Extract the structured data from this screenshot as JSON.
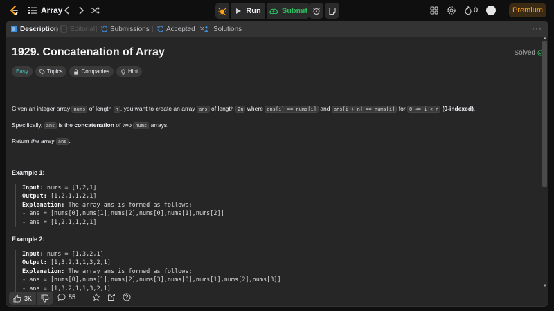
{
  "topbar": {
    "problem_list_title": "Array",
    "run_label": "Run",
    "submit_label": "Submit",
    "streak_count": "0",
    "premium_label": "Premium"
  },
  "tabs": [
    {
      "label": "Description",
      "state": "active",
      "icon": "description-icon"
    },
    {
      "label": "Editorial",
      "state": "disabled",
      "icon": "editorial-icon"
    },
    {
      "label": "Submissions",
      "state": "normal",
      "icon": "submissions-icon"
    },
    {
      "label": "Accepted",
      "state": "normal",
      "icon": "accepted-icon"
    },
    {
      "label": "Solutions",
      "state": "normal",
      "icon": "solutions-icon"
    }
  ],
  "problem": {
    "title": "1929. Concatenation of Array",
    "status": "Solved",
    "difficulty": "Easy",
    "chips": [
      "Topics",
      "Companies",
      "Hint"
    ],
    "desc1": {
      "t1": "Given an integer array ",
      "c1": "nums",
      "t2": " of length ",
      "c2": "n",
      "t3": ", you want to create an array ",
      "c3": "ans",
      "t4": " of length ",
      "c4": "2n",
      "t5": " where ",
      "c5": "ans[i] == nums[i]",
      "t6": " and ",
      "c6": "ans[i + n] == nums[i]",
      "t7": " for ",
      "c7": "0 <= i < n",
      "b1": "(0-indexed)",
      "t8": "."
    },
    "desc2": {
      "t1": "Specifically, ",
      "c1": "ans",
      "t2": " is the ",
      "b1": "concatenation",
      "t3": " of two ",
      "c2": "nums",
      "t4": " arrays."
    },
    "desc3": {
      "t1": "Return ",
      "i1": "the array",
      "c1": "ans",
      "t2": "."
    },
    "examples": [
      {
        "title": "Example 1:",
        "input_label": "Input:",
        "input": " nums = [1,2,1]",
        "output_label": "Output:",
        "output": " [1,2,1,1,2,1]",
        "explanation_label": "Explanation:",
        "explanation": " The array ans is formed as follows:",
        "line1": "- ans = [nums[0],nums[1],nums[2],nums[0],nums[1],nums[2]]",
        "line2": "- ans = [1,2,1,1,2,1]"
      },
      {
        "title": "Example 2:",
        "input_label": "Input:",
        "input": " nums = [1,3,2,1]",
        "output_label": "Output:",
        "output": " [1,3,2,1,1,3,2,1]",
        "explanation_label": "Explanation:",
        "explanation": " The array ans is formed as follows:",
        "line1": "- ans = [nums[0],nums[1],nums[2],nums[3],nums[0],nums[1],nums[2],nums[3]]",
        "line2": "- ans = [1,3,2,1,1,3,2,1]"
      }
    ]
  },
  "footer": {
    "likes": "3K",
    "comments": "55"
  },
  "colors": {
    "accent_green": "#2cbb5d",
    "easy_teal": "#46c6c2",
    "premium_orange": "#ffa116"
  }
}
